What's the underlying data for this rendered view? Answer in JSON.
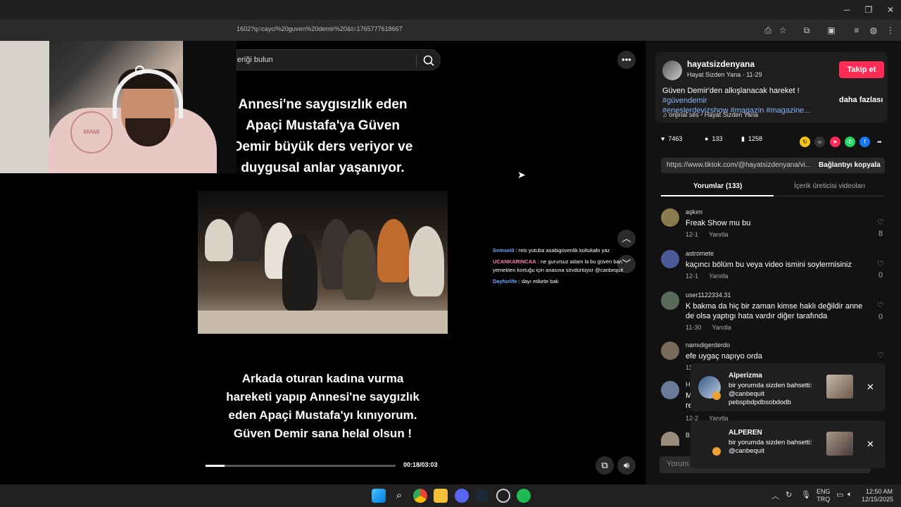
{
  "browser": {
    "url": "1602?q=cayci%20guven%20demir%20&t=1765777618667",
    "minimize": "─",
    "maximize": "❐",
    "close": "✕"
  },
  "search": {
    "placeholder": "eriği bulun"
  },
  "video": {
    "caption_top": [
      "Annesi'ne saygısızlık eden",
      "Apaçi Mustafa'ya Güven",
      "Demir büyük ders veriyor ve",
      "duygusal anlar yaşanıyor."
    ],
    "caption_bottom": [
      "Arkada oturan kadına vurma",
      "hareketi yapıp Annesi'ne saygızlık",
      "eden Apaçi Mustafa'yı kınıyorum.",
      "Güven Demir sana helal olsun !"
    ],
    "time": "00:18/03:03",
    "progress": 0.1
  },
  "chat": [
    {
      "nick": "Semsei0",
      "color": "#6aa8ff",
      "text": " : reis yutuba asabigüvenlik koltukaltı yaz"
    },
    {
      "nick": "UCANKARINCAA",
      "color": "#ff7ab0",
      "text": " : ne gurursuz adam la bu güven ban yemekten kortuğu için anasına sövdürtüyor @canbequit"
    },
    {
      "nick": "Dayforlife",
      "color": "#6aa8ff",
      "text": " : dayı etikete bak"
    }
  ],
  "post": {
    "author": "hayatsizdenyana",
    "subtitle": "Hayat Sizden Yana · 11-29",
    "follow": "Takip et",
    "desc_plain": "Güven Demir'den alkışlanacak hareket ! ",
    "tag1": "#güvendemir",
    "tags2": "#eneslerdeyizshow #magazin #magazine...",
    "more": "daha fazlası",
    "music": "♫  orijinal ses - Hayat Sizden Yana"
  },
  "stats": {
    "likes": "7463",
    "comments": "133",
    "saves": "1258"
  },
  "link": {
    "url": "https://www.tiktok.com/@hayatsizdenyana/vi...",
    "copy": "Bağlantıyı kopyala"
  },
  "tabs": {
    "comments": "Yorumlar (133)",
    "creator": "İçerik üreticisi videoları"
  },
  "comments": [
    {
      "user": "aşkım",
      "text": "Freak Show mu bu",
      "date": "12-1",
      "reply": "Yanıtla",
      "likes": "8"
    },
    {
      "user": "astromete",
      "text": "kaçıncı bölüm bu veya video ismini soylermisiniz",
      "date": "12-1",
      "reply": "Yanıtla",
      "likes": "0"
    },
    {
      "user": "user1122334.31",
      "text": "K bakma da hiç bir zaman kimse haklı değildir anne de olsa yaptıgı hata vardır diğer tarafında",
      "date": "11-30",
      "reply": "Yanıtla",
      "likes": "0"
    },
    {
      "user": "namıdigerderdo",
      "text": "efe uygaç napıyo orda",
      "date": "11",
      "reply": "",
      "likes": ""
    },
    {
      "user": "H",
      "text": "M re",
      "date": "12-2",
      "reply": "Yanıtla",
      "likes": ""
    },
    {
      "user": "B",
      "text": "",
      "date": "",
      "reply": "",
      "likes": ""
    }
  ],
  "comment_input": "Yorum",
  "toasts": [
    {
      "name": "Alperizma",
      "msg": "bir yorumda sizden bahsetti: @canbequit pebspbdpdbsobdodb"
    },
    {
      "name": "ALPEREN",
      "msg": "bir yorumda sizden bahsetti: @canbequit"
    }
  ],
  "tray": {
    "lang1": "ENG",
    "lang2": "TRQ",
    "time": "12:50 AM",
    "date": "12/15/2025"
  }
}
